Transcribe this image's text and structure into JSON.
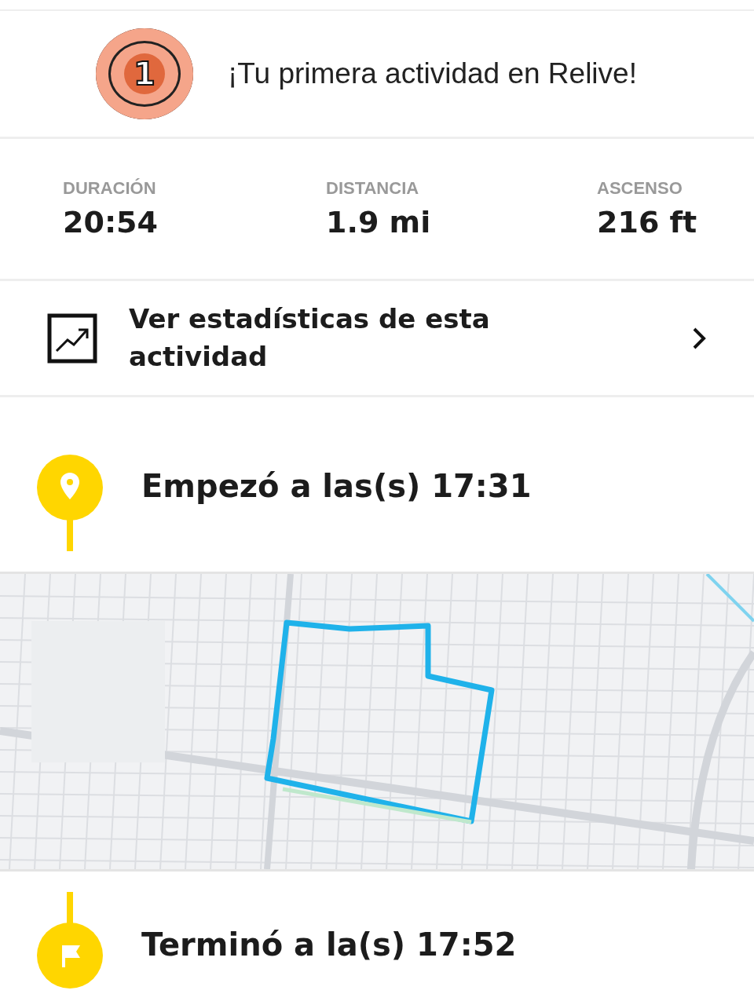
{
  "achievement": {
    "number": "1",
    "text": "¡Tu primera actividad en Relive!"
  },
  "stats": [
    {
      "label": "DURACIÓN",
      "value": "20:54"
    },
    {
      "label": "DISTANCIA",
      "value": "1.9 mi"
    },
    {
      "label": "ASCENSO",
      "value": "216 ft"
    }
  ],
  "stats_link": {
    "text": "Ver estadísticas de esta actividad"
  },
  "timeline": [
    {
      "kind": "start",
      "text": "Empezó a las(s) 17:31"
    },
    {
      "kind": "map"
    },
    {
      "kind": "end",
      "text": "Terminó a la(s) 17:52"
    }
  ]
}
